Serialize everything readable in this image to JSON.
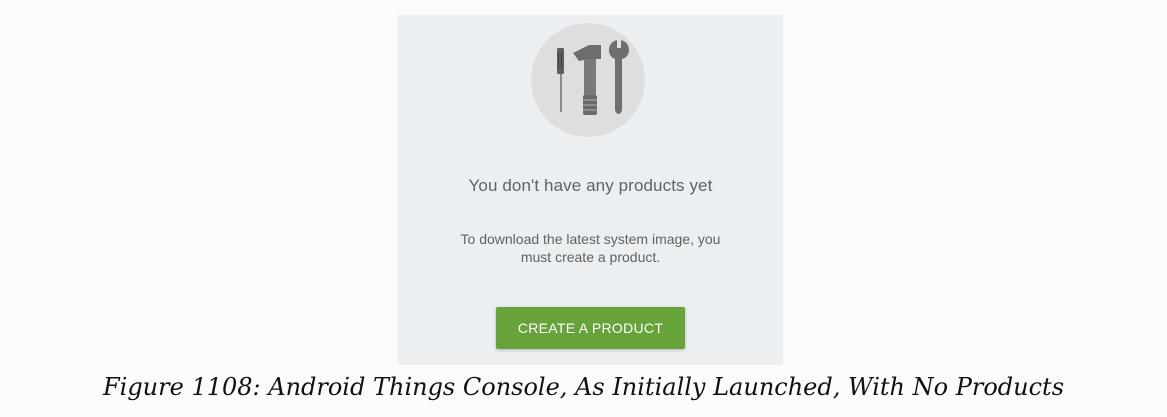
{
  "empty_state": {
    "illustration_icon": "tools-icon",
    "title": "You don't have any products yet",
    "description_line1": "To download the latest system image, you",
    "description_line2": "must create a product.",
    "create_button_label": "CREATE A PRODUCT"
  },
  "caption": "Figure 1108: Android Things Console, As Initially Launched, With No Products",
  "colors": {
    "panel_background": "#eceff1",
    "button_green": "#67a23b",
    "illustration_circle": "#dcdee0",
    "tool_gray": "#6d6d6d"
  }
}
